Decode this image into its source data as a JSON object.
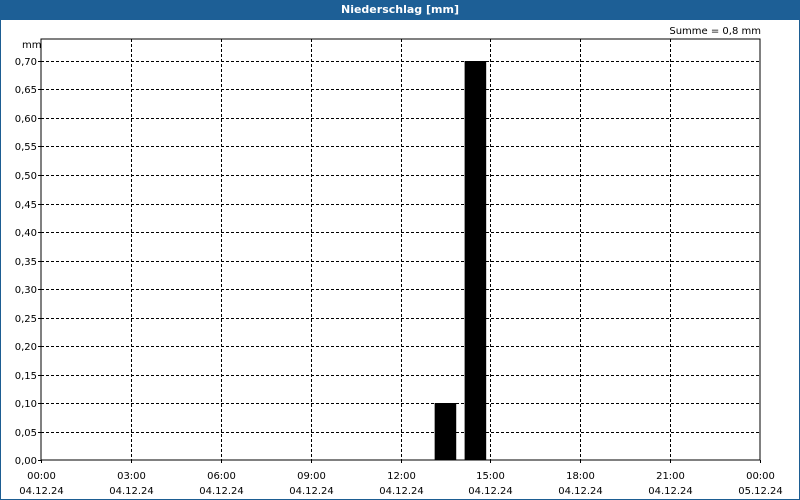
{
  "window": {
    "title": "Niederschlag [mm]"
  },
  "summary": "Summe = 0,8 mm",
  "colors": {
    "titlebar": "#1d5f96",
    "bar": "#000000",
    "grid": "#000000"
  },
  "chart_data": {
    "type": "bar",
    "unit_label": "mm",
    "y_tick_labels": [
      "0,00",
      "0,05",
      "0,10",
      "0,15",
      "0,20",
      "0,25",
      "0,30",
      "0,35",
      "0,40",
      "0,45",
      "0,50",
      "0,55",
      "0,60",
      "0,65",
      "0,70"
    ],
    "y_ticks": [
      0,
      0.05,
      0.1,
      0.15,
      0.2,
      0.25,
      0.3,
      0.35,
      0.4,
      0.45,
      0.5,
      0.55,
      0.6,
      0.65,
      0.7
    ],
    "ylim": [
      0,
      0.7
    ],
    "xlim_hours": [
      0,
      24
    ],
    "x_ticks": [
      {
        "hour": 0,
        "time": "00:00",
        "date": "04.12.24"
      },
      {
        "hour": 3,
        "time": "03:00",
        "date": "04.12.24"
      },
      {
        "hour": 6,
        "time": "06:00",
        "date": "04.12.24"
      },
      {
        "hour": 9,
        "time": "09:00",
        "date": "04.12.24"
      },
      {
        "hour": 12,
        "time": "12:00",
        "date": "04.12.24"
      },
      {
        "hour": 15,
        "time": "15:00",
        "date": "04.12.24"
      },
      {
        "hour": 18,
        "time": "18:00",
        "date": "04.12.24"
      },
      {
        "hour": 21,
        "time": "21:00",
        "date": "04.12.24"
      },
      {
        "hour": 24,
        "time": "00:00",
        "date": "05.12.24"
      }
    ],
    "series": [
      {
        "bars": [
          {
            "start_hour": 13,
            "end_hour": 14,
            "value": 0.1
          },
          {
            "start_hour": 14,
            "end_hour": 15,
            "value": 0.7
          }
        ]
      }
    ],
    "grid": true
  }
}
